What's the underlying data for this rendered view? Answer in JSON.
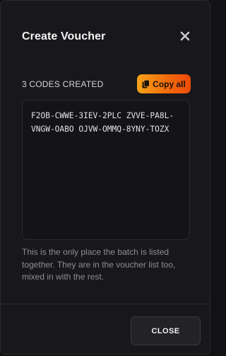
{
  "dialog": {
    "title": "Create Voucher",
    "close_icon": "close-x-icon"
  },
  "codes": {
    "count_label": "3 CODES CREATED",
    "copy_all_label": "Copy all",
    "copy_icon": "copy-icon",
    "text": "F2OB-CWWE-3IEV-2PLC ZVVE-PA8L-VNGW-OABO OJVW-OMMQ-8YNY-TOZX"
  },
  "note": "This is the only place the batch is listed together. They are in the voucher list too, mixed in with the rest.",
  "footer": {
    "close_label": "CLOSE"
  },
  "colors": {
    "accent_start": "#f7a21a",
    "accent_end": "#ee4a08",
    "background": "#18181b"
  }
}
